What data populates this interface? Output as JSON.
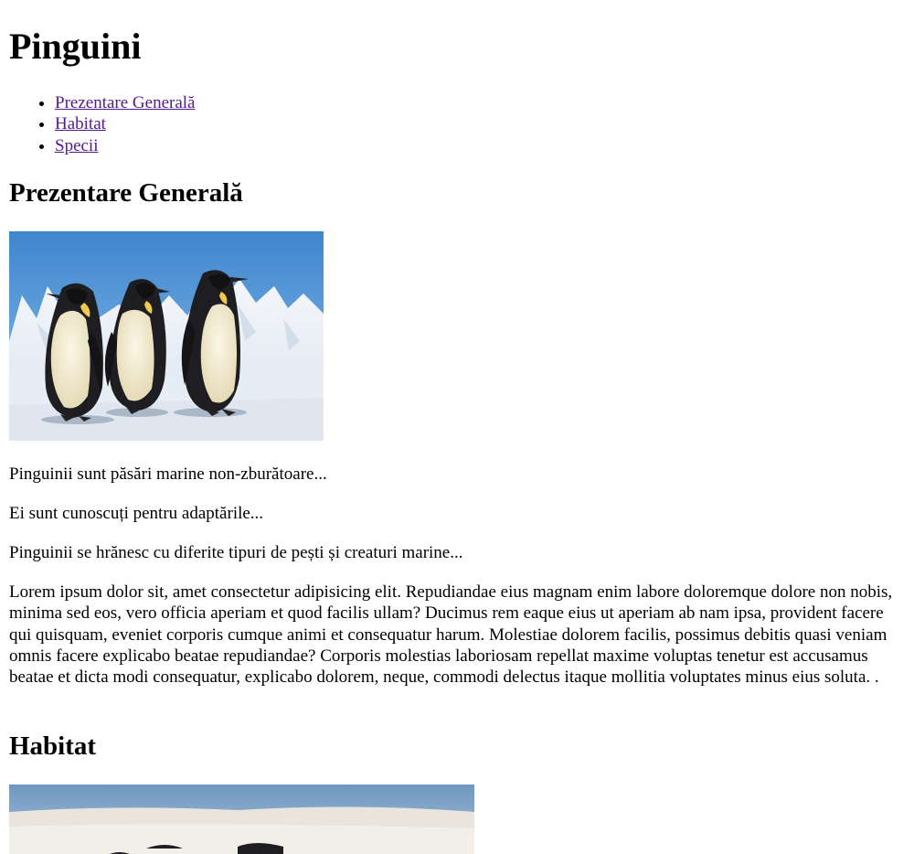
{
  "page": {
    "title": "Pinguini"
  },
  "nav": {
    "items": [
      {
        "label": "Prezentare Generală"
      },
      {
        "label": "Habitat"
      },
      {
        "label": "Specii"
      }
    ]
  },
  "sections": {
    "general": {
      "heading": "Prezentare Generală",
      "paragraphs": [
        "Pinguinii sunt păsări marine non-zburătoare...",
        "Ei sunt cunoscuți pentru adaptările...",
        "Pinguinii se hrănesc cu diferite tipuri de pești și creaturi marine...",
        "Lorem ipsum dolor sit, amet consectetur adipisicing elit. Repudiandae eius magnam enim labore doloremque dolore non nobis, minima sed eos, vero officia aperiam et quod facilis ullam? Ducimus rem eaque eius ut aperiam ab nam ipsa, provident facere qui quisquam, eveniet corporis cumque animi et consequatur harum. Molestiae dolorem facilis, possimus debitis quasi veniam omnis facere explicabo beatae repudiandae? Corporis molestias laboriosam repellat maxime voluptas tenetur est accusamus beatae et dicta modi consequatur, explicabo dolorem, neque, commodi delectus itaque mollitia voluptates minus eius soluta. ."
      ]
    },
    "habitat": {
      "heading": "Habitat"
    }
  },
  "colors": {
    "link_visited": "#551a8b",
    "sky": "#5b9ad6",
    "snow": "#eef2f7"
  }
}
